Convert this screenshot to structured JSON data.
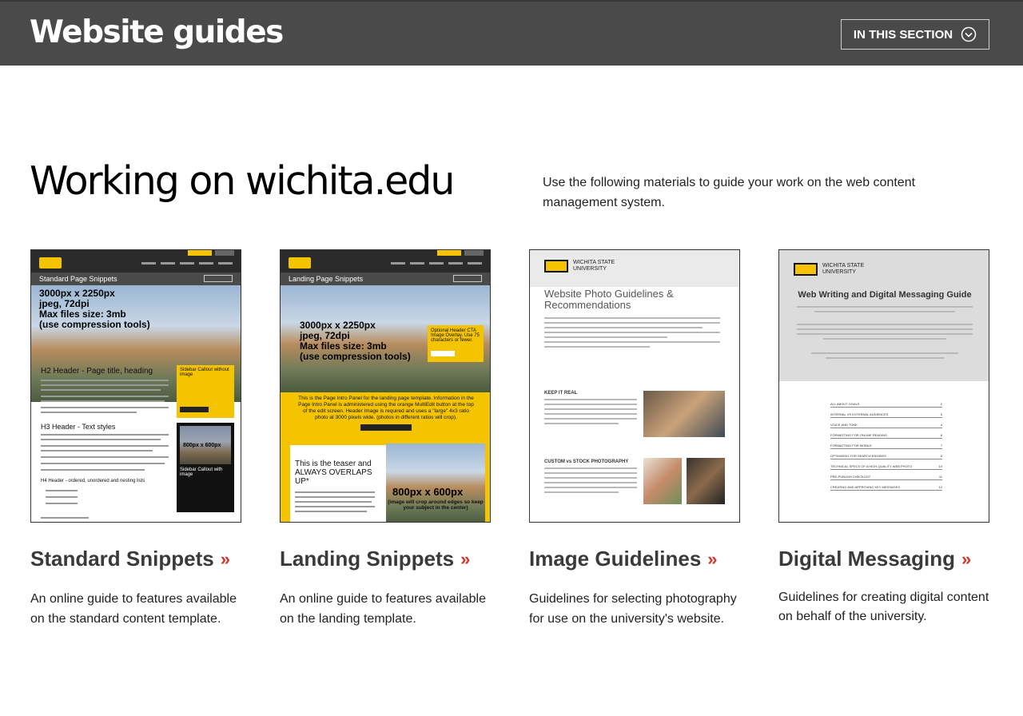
{
  "header": {
    "site_title": "Website guides",
    "section_button_label": "IN THIS SECTION"
  },
  "main": {
    "heading": "Working on wichita.edu",
    "intro": "Use the following materials to guide your work on the web content management system."
  },
  "cards": [
    {
      "title": "Standard Snippets",
      "description": "An online guide to features available on the standard content template.",
      "thumb": {
        "section_label": "Standard Page Snippets",
        "overlay": "3000px x 2250px\njpeg, 72dpi\nMax files size: 3mb\n(use compression tools)",
        "h2": "H2 Header - Page title, heading",
        "h3": "H3 Header - Text styles",
        "h4": "H4 Header - ordered, unordered and nesting lists",
        "callout": "Sidebar Callout without image",
        "image_size": "800px x 600px",
        "callout2": "Sidebar Callout with image"
      }
    },
    {
      "title": "Landing Snippets",
      "description": "An online guide to features available on the landing template.",
      "thumb": {
        "section_label": "Landing Page Snippets",
        "overlay": "3000px x 2250px\njpeg, 72dpi\nMax files size: 3mb\n(use compression tools)",
        "cta": "Optional Header CTA Image Overlay. Use 75 characters or fewer.",
        "intro_panel": "This is the Page Intro Panel for the landing page template. Information in the Page Intro Panel is administered using the orange MultiEdit button at the top of the edit screen. Header Image is required and uses a \"large\" 4x3 ratio photo at 3000 pixels wide. (photos in different ratios will crop).",
        "teaser": "This is the teaser and ALWAYS OVERLAPS UP*",
        "image_size": "800px x 600px",
        "image_note": "(image will crop around edges so keep your subject in the center)"
      }
    },
    {
      "title": "Image Guidelines",
      "description": "Guidelines for selecting photography for use on the university's website.",
      "thumb": {
        "logo_text": "WICHITA STATE\nUNIVERSITY",
        "doc_title": "Website Photo Guidelines & Recommendations",
        "sub1": "KEEP IT REAL",
        "sub2": "CUSTOM vs STOCK PHOTOGRAPHY"
      }
    },
    {
      "title": "Digital Messaging",
      "description": "Guidelines for creating digital content on behalf of the university.",
      "thumb": {
        "logo_text": "WICHITA STATE\nUNIVERSITY",
        "doc_title": "Web Writing and Digital Messaging Guide",
        "toc": [
          "ALL ABOUT GOALS",
          "INTERNAL VS EXTERNAL AUDIENCES",
          "VOICE AND TONE",
          "FORMATTING FOR ONLINE READING",
          "FORMATTING FOR MOBILE",
          "OPTIMIZING FOR SEARCH ENGINES",
          "TECHNICAL SPECS OF A HIGH-QUALITY WEB PHOTO",
          "PRE-PUBLISH CHECKLIST",
          "CREATING AND APPROVING KEY MESSAGES"
        ],
        "toc_pages": [
          "2",
          "3",
          "4",
          "6",
          "7",
          "8",
          "10",
          "11",
          "12"
        ]
      }
    }
  ],
  "colors": {
    "header_bg": "#4a4a4a",
    "accent_chevron": "#d0382b",
    "wsu_yellow": "#f5c400"
  }
}
